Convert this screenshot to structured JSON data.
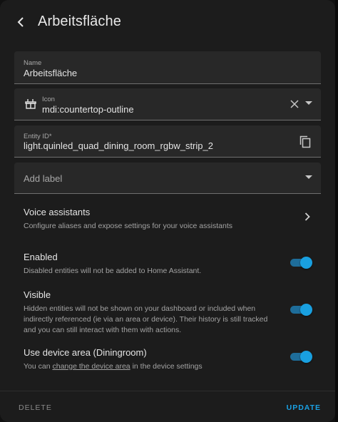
{
  "header": {
    "title": "Arbeitsfläche",
    "back_icon": "arrow-left-icon"
  },
  "fields": {
    "name": {
      "label": "Name",
      "value": "Arbeitsfläche"
    },
    "icon": {
      "label": "Icon",
      "value": "mdi:countertop-outline",
      "icon": "countertop-outline-icon"
    },
    "entity_id": {
      "label": "Entity ID*",
      "value": "light.quinled_quad_dining_room_rgbw_strip_2"
    },
    "add_label": {
      "placeholder": "Add label"
    }
  },
  "voice": {
    "title": "Voice assistants",
    "subtitle": "Configure aliases and expose settings for your voice assistants"
  },
  "enabled": {
    "title": "Enabled",
    "subtitle": "Disabled entities will not be added to Home Assistant.",
    "on": true
  },
  "visible": {
    "title": "Visible",
    "subtitle_lines": [
      "Hidden entities will not be shown on your dashboard or included when",
      "indirectly referenced (ie via an area or device). Their history is still tracked",
      "and you can still interact with them with actions."
    ],
    "on": true
  },
  "device_area": {
    "title": "Use device area (Diningroom)",
    "subtitle_prefix": "You can ",
    "subtitle_link": "change the device area",
    "subtitle_suffix": " in the device settings",
    "on": true
  },
  "footer": {
    "delete_label": "DELETE",
    "update_label": "UPDATE"
  },
  "colors": {
    "accent": "#19a0e0",
    "dialog_bg": "#1c1c1c",
    "field_bg": "#282828"
  }
}
